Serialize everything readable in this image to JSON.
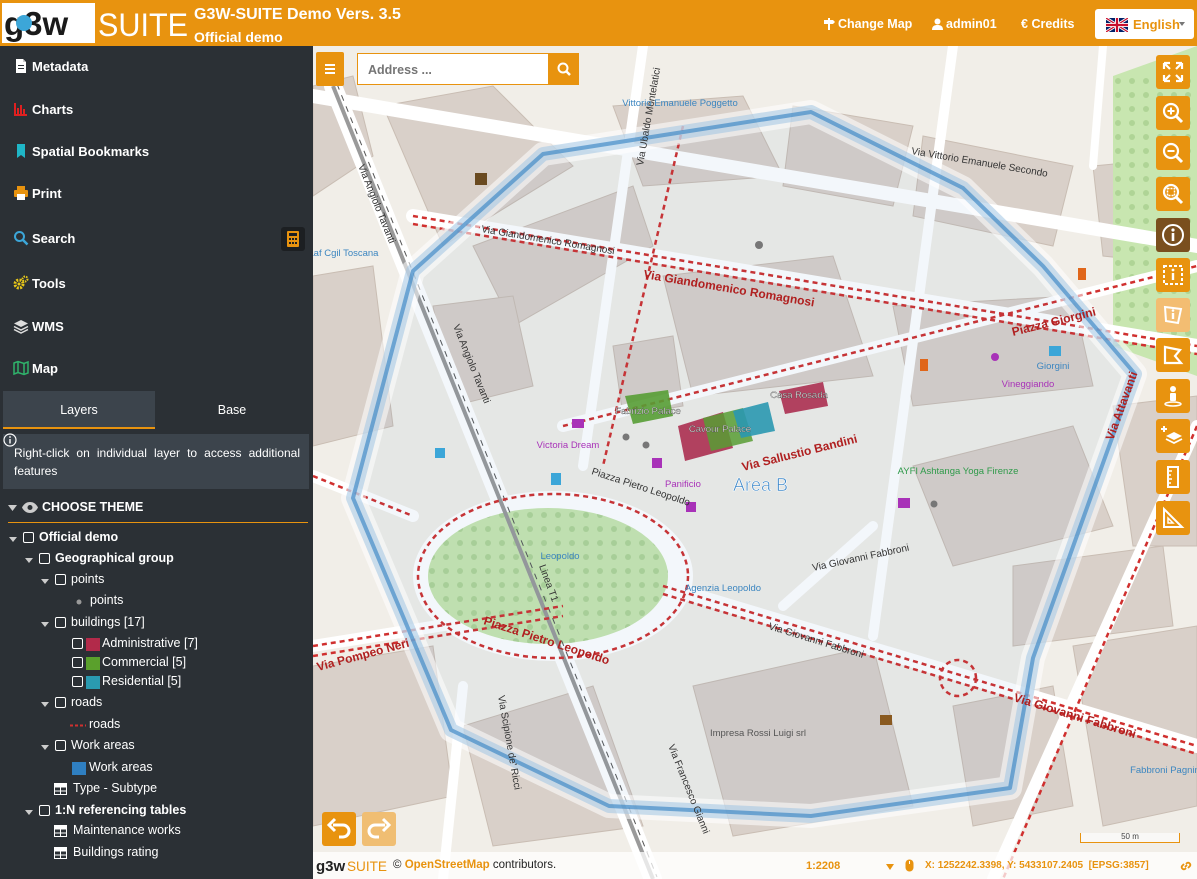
{
  "header": {
    "logo_text": "g3w SUITE",
    "title": "G3W-SUITE Demo Vers. 3.5",
    "subtitle": "Official demo",
    "change_map_label": "Change Map",
    "user_label": "admin01",
    "credits_label": "Credits",
    "language_label": "English"
  },
  "sidebar": {
    "menu": [
      {
        "label": "Metadata",
        "icon": "file-icon"
      },
      {
        "label": "Charts",
        "icon": "bar-chart-icon"
      },
      {
        "label": "Spatial Bookmarks",
        "icon": "bookmark-icon"
      },
      {
        "label": "Print",
        "icon": "printer-icon"
      },
      {
        "label": "Search",
        "icon": "search-icon"
      },
      {
        "label": "Tools",
        "icon": "cogs-icon"
      },
      {
        "label": "WMS",
        "icon": "layers-icon"
      },
      {
        "label": "Map",
        "icon": "map-icon"
      }
    ],
    "tabs": {
      "layers": "Layers",
      "base": "Base"
    },
    "info_text": "Right-click on individual layer to access additional features",
    "choose_theme": "CHOOSE THEME",
    "tree": [
      {
        "label": "Official demo",
        "bold": true
      },
      {
        "label": "Geographical group",
        "bold": true
      },
      {
        "label": "points"
      },
      {
        "label": "points"
      },
      {
        "label": "buildings [17]"
      },
      {
        "label": "Administrative [7]",
        "color": "#b22a4a"
      },
      {
        "label": "Commercial [5]",
        "color": "#5aa02c"
      },
      {
        "label": "Residential [5]",
        "color": "#2a9ab0"
      },
      {
        "label": "roads"
      },
      {
        "label": "roads"
      },
      {
        "label": "Work areas"
      },
      {
        "label": "Work areas",
        "color": "#2f7fc1"
      },
      {
        "label": "Type - Subtype"
      },
      {
        "label": "1:N referencing tables",
        "bold": true
      },
      {
        "label": "Maintenance works"
      },
      {
        "label": "Buildings rating"
      }
    ]
  },
  "map": {
    "search_placeholder": "Address ...",
    "area_label": "Area B",
    "scale_bar_label": "50 m",
    "attribution_prefix": "©",
    "attribution_link": "OpenStreetMap",
    "attribution_suffix": "contributors.",
    "scale": "1:2208",
    "coordinates": "X: 1252242.3398, Y: 5433107.2405",
    "crs": "[EPSG:3857]",
    "street_labels": [
      "Via Giandomenico Romagnosi",
      "Via Sallustio Bandini",
      "Piazza Pietro Leopoldo",
      "Via Giovanni Fabbroni",
      "Via Angiolo Tavanti",
      "Via Ubaldo Montelatici",
      "Via Vittorio Emanuele Secondo",
      "Via Pompeo Neri",
      "Via Francesco Gianni",
      "Piazza Giorgini",
      "Via Scipione de' Ricci",
      "Linea T1",
      "Via Attavanti"
    ],
    "poi_labels": [
      "Fabrizio Palace",
      "Cavour Palace",
      "Casa Rosada",
      "Victoria Dream",
      "Panificio",
      "AYFI Ashtanga Yoga Firenze",
      "Agenzia Leopoldo",
      "Impresa Rossi Luigi srl",
      "Caaf Cgil Toscana",
      "Vittorio Emanuele Poggetto",
      "Vineggiando",
      "Giorgini",
      "Leopoldo",
      "Fabbroni Pagnini"
    ],
    "colors": {
      "accent": "#e8930f",
      "area": "#2f7fc1",
      "roads": "#d0302f"
    }
  }
}
